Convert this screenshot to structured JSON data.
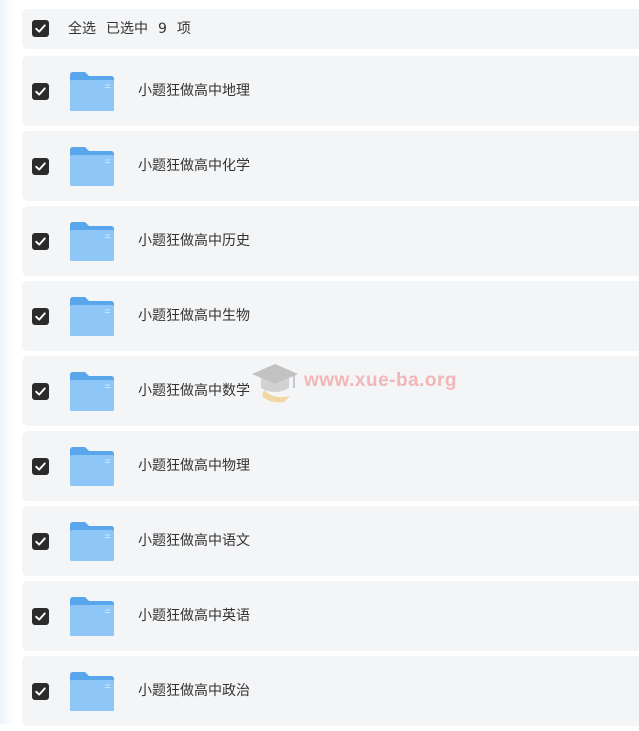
{
  "header": {
    "select_all": "全选",
    "selected_prefix": "已选中",
    "selected_count": "9",
    "selected_suffix": "项",
    "checked": true
  },
  "items": [
    {
      "label": "小题狂做高中地理",
      "checked": true,
      "icon": "folder-icon"
    },
    {
      "label": "小题狂做高中化学",
      "checked": true,
      "icon": "folder-icon"
    },
    {
      "label": "小题狂做高中历史",
      "checked": true,
      "icon": "folder-icon"
    },
    {
      "label": "小题狂做高中生物",
      "checked": true,
      "icon": "folder-icon"
    },
    {
      "label": "小题狂做高中数学",
      "checked": true,
      "icon": "folder-icon"
    },
    {
      "label": "小题狂做高中物理",
      "checked": true,
      "icon": "folder-icon"
    },
    {
      "label": "小题狂做高中语文",
      "checked": true,
      "icon": "folder-icon"
    },
    {
      "label": "小题狂做高中英语",
      "checked": true,
      "icon": "folder-icon"
    },
    {
      "label": "小题狂做高中政治",
      "checked": true,
      "icon": "folder-icon"
    }
  ],
  "watermark": {
    "text": "www.xue-ba.org"
  },
  "colors": {
    "row_background": "#f4f5f7",
    "checkbox": "#2b2b2b",
    "folder_back": "#5aa6ec",
    "folder_front": "#8ec6f7",
    "text": "#333333",
    "watermark": "#f06a6a"
  }
}
